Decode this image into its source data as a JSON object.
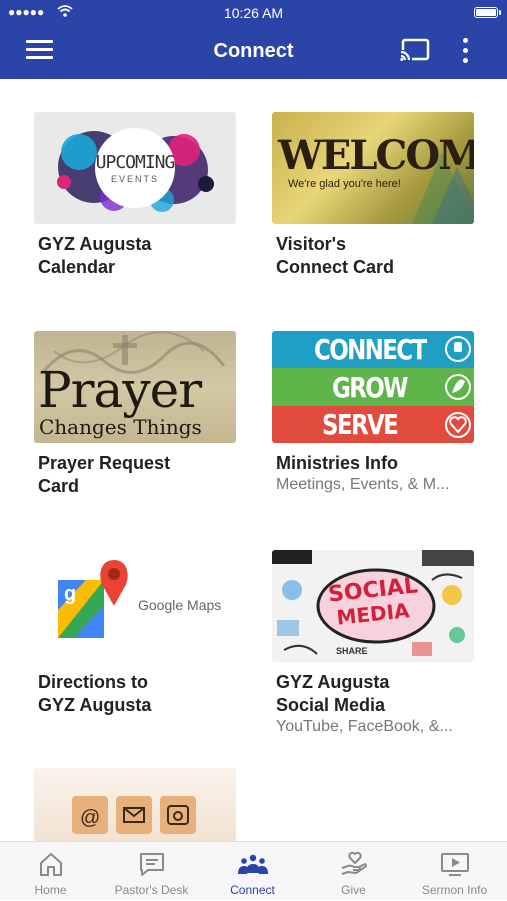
{
  "status": {
    "time": "10:26 AM"
  },
  "header": {
    "title": "Connect"
  },
  "cards": [
    {
      "title": "GYZ Augusta\nCalendar",
      "subtitle": "",
      "image_text": "UPCOMING",
      "image_text2": "EVENTS"
    },
    {
      "title": "Visitor's\nConnect Card",
      "subtitle": "",
      "image_text": "WELCOME",
      "image_text2": "We're glad you're here!"
    },
    {
      "title": "Prayer Request\nCard",
      "subtitle": "",
      "image_text": "Prayer",
      "image_text2": "Changes Things"
    },
    {
      "title": "Ministries Info",
      "subtitle": "Meetings, Events, & M...",
      "image_text": "CONNECT",
      "image_text2": "GROW",
      "image_text3": "SERVE"
    },
    {
      "title": "Directions to\nGYZ Augusta",
      "subtitle": "",
      "image_text": "Google Maps"
    },
    {
      "title": "GYZ Augusta\nSocial Media",
      "subtitle": "YouTube, FaceBook, &...",
      "image_text": "SOCIAL",
      "image_text2": "MEDIA",
      "image_text3": "SHARE"
    }
  ],
  "tabs": [
    {
      "label": "Home",
      "icon": "home-icon"
    },
    {
      "label": "Pastor's Desk",
      "icon": "message-icon"
    },
    {
      "label": "Connect",
      "icon": "people-icon"
    },
    {
      "label": "Give",
      "icon": "hand-heart-icon"
    },
    {
      "label": "Sermon Info",
      "icon": "play-screen-icon"
    }
  ],
  "colors": {
    "header": "#2a44a8",
    "active_tab": "#2a44a8",
    "inactive_tab": "#8a8a8a"
  }
}
